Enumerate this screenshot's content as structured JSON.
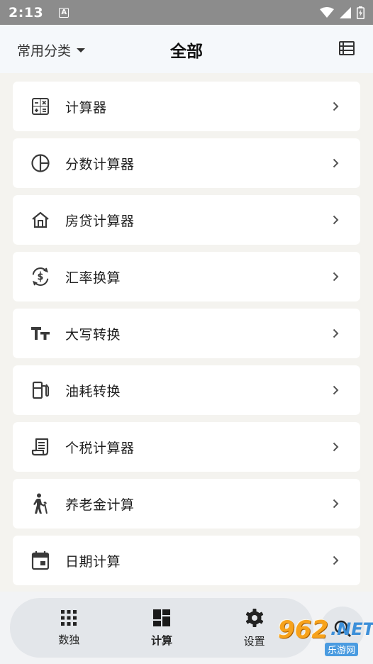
{
  "status_bar": {
    "time": "2:13",
    "notif_letter": "A"
  },
  "header": {
    "category_label": "常用分类",
    "title": "全部"
  },
  "items": [
    {
      "label": "计算器",
      "icon": "calculator-icon"
    },
    {
      "label": "分数计算器",
      "icon": "pie-chart-icon"
    },
    {
      "label": "房贷计算器",
      "icon": "house-icon"
    },
    {
      "label": "汇率换算",
      "icon": "currency-exchange-icon"
    },
    {
      "label": "大写转换",
      "icon": "text-size-icon"
    },
    {
      "label": "油耗转换",
      "icon": "fuel-station-icon"
    },
    {
      "label": "个税计算器",
      "icon": "receipt-icon"
    },
    {
      "label": "养老金计算",
      "icon": "elderly-walking-icon"
    },
    {
      "label": "日期计算",
      "icon": "calendar-icon"
    }
  ],
  "nav": {
    "tabs": [
      {
        "label": "数独",
        "icon": "grid-dots-icon"
      },
      {
        "label": "计算",
        "icon": "dashboard-icon",
        "active": true
      },
      {
        "label": "设置",
        "icon": "gear-icon"
      }
    ],
    "search_icon": "search-icon"
  },
  "watermark": {
    "number": "962",
    "suffix": ".NET",
    "site": "乐游网"
  },
  "colors": {
    "icon": "#3a3a3a",
    "background": "#f4f3ef",
    "card": "#ffffff",
    "nav": "#e3e6ea"
  }
}
